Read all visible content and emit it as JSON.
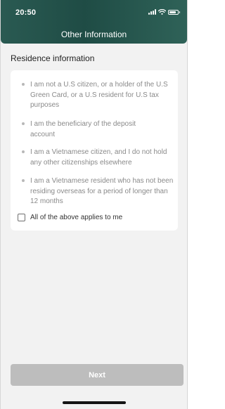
{
  "status_bar": {
    "time": "20:50",
    "icons": [
      "signal-icon",
      "wifi-icon",
      "battery-icon"
    ]
  },
  "header": {
    "title": "Other Information"
  },
  "section": {
    "title": "Residence information"
  },
  "declarations": [
    "I am not a U.S citizen, or a holder of the U.S Green Card, or a U.S resident for U.S tax purposes",
    "I am the beneficiary of the deposit account",
    "I am a Vietnamese citizen, and I do not hold any other citizenships elsewhere",
    "I am a Vietnamese resident who has not been residing overseas for a period of longer than 12 months"
  ],
  "confirm": {
    "label": "All of the above applies to me",
    "checked": false
  },
  "footer": {
    "next_label": "Next"
  },
  "colors": {
    "header": "#1f4c45",
    "button_disabled": "#bdbdbd",
    "background": "#f2f2f2"
  }
}
